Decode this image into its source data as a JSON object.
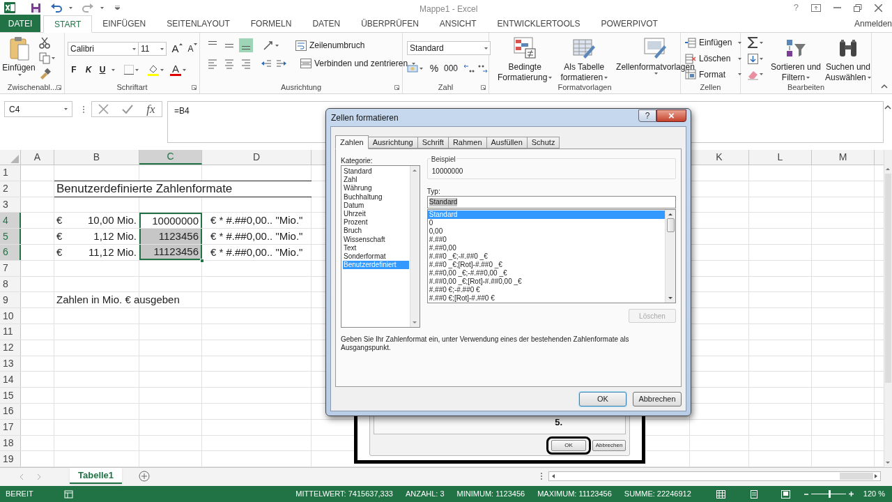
{
  "title_bar": {
    "title": "Mappe1 - Excel",
    "help": "?"
  },
  "ribbon_tabs": [
    {
      "label": "DATEI",
      "kind": "file",
      "selected": false
    },
    {
      "label": "START",
      "kind": "tab",
      "selected": true
    },
    {
      "label": "EINFÜGEN",
      "kind": "tab",
      "selected": false
    },
    {
      "label": "SEITENLAYOUT",
      "kind": "tab",
      "selected": false
    },
    {
      "label": "FORMELN",
      "kind": "tab",
      "selected": false
    },
    {
      "label": "DATEN",
      "kind": "tab",
      "selected": false
    },
    {
      "label": "ÜBERPRÜFEN",
      "kind": "tab",
      "selected": false
    },
    {
      "label": "ANSICHT",
      "kind": "tab",
      "selected": false
    },
    {
      "label": "ENTWICKLERTOOLS",
      "kind": "tab",
      "selected": false
    },
    {
      "label": "POWERPIVOT",
      "kind": "tab",
      "selected": false
    }
  ],
  "account": "Anmelden",
  "ribbon_groups": [
    {
      "kind": "clipboard",
      "label": "Zwischenabl...",
      "paste": "Einfügen"
    },
    {
      "kind": "font",
      "label": "Schriftart",
      "font_name": "Calibri",
      "font_size": "11",
      "grow": "A",
      "shrink": "A",
      "bold": "F",
      "italic": "K",
      "underline": "U",
      "font_color": "A"
    },
    {
      "kind": "alignment",
      "label": "Ausrichtung",
      "vertical_align": [
        {
          "selected": false
        },
        {
          "selected": false
        },
        {
          "selected": true
        }
      ],
      "wrap": "Zeilenumbruch",
      "merge": "Verbinden und zentrieren"
    },
    {
      "kind": "number",
      "label": "Zahl",
      "format": "Standard",
      "percent": "%",
      "thousands": "000"
    },
    {
      "kind": "styles",
      "label": "Formatvorlagen",
      "buttons": [
        [
          "Bedingte",
          "Formatierung"
        ],
        [
          "Als Tabelle",
          "formatieren"
        ],
        [
          "Zellenformatvorlagen"
        ]
      ]
    },
    {
      "kind": "cells",
      "label": "Zellen",
      "buttons": [
        "Einfügen",
        "Löschen",
        "Format"
      ]
    },
    {
      "kind": "editing",
      "label": "Bearbeiten",
      "buttons": [
        [
          "Sortieren und",
          "Filtern"
        ],
        [
          "Suchen und",
          "Auswählen"
        ]
      ]
    }
  ],
  "formula_bar": {
    "name_box": "C4",
    "function": "fx",
    "formula": "=B4"
  },
  "columns": [
    {
      "label": "A",
      "selected": false
    },
    {
      "label": "B",
      "selected": false
    },
    {
      "label": "C",
      "selected": true
    },
    {
      "label": "D",
      "selected": false
    },
    {
      "label": "K",
      "selected": false
    },
    {
      "label": "L",
      "selected": false
    },
    {
      "label": "M",
      "selected": false
    }
  ],
  "rows": [
    {
      "label": "1",
      "selected": false
    },
    {
      "label": "2",
      "selected": false,
      "B": {
        "text": "Benutzerdefinierte Zahlenformate",
        "kind": "title"
      }
    },
    {
      "label": "3",
      "selected": false
    },
    {
      "label": "4",
      "selected": true,
      "B": {
        "currency": "€",
        "text": "10,00 Mio."
      },
      "C": {
        "text": "10000000",
        "selected": true,
        "active": true
      },
      "D": {
        "text": "€ * #.##0,00.. \"Mio.\""
      }
    },
    {
      "label": "5",
      "selected": true,
      "B": {
        "currency": "€",
        "text": "1,12 Mio."
      },
      "C": {
        "text": "1123456",
        "selected": true,
        "active": false
      },
      "D": {
        "text": "€ * #.##0,00.. \"Mio.\""
      }
    },
    {
      "label": "6",
      "selected": true,
      "B": {
        "currency": "€",
        "text": "11,12 Mio."
      },
      "C": {
        "text": "11123456",
        "selected": true,
        "active": false
      },
      "D": {
        "text": "€ * #.##0,00.. \"Mio.\""
      }
    },
    {
      "label": "7",
      "selected": false
    },
    {
      "label": "8",
      "selected": false
    },
    {
      "label": "9",
      "selected": false,
      "B": {
        "text": "Zahlen in Mio. € ausgeben",
        "kind": "note"
      }
    },
    {
      "label": "10",
      "selected": false
    },
    {
      "label": "11",
      "selected": false
    },
    {
      "label": "12",
      "selected": false
    },
    {
      "label": "13",
      "selected": false
    },
    {
      "label": "14",
      "selected": false
    },
    {
      "label": "15",
      "selected": false
    },
    {
      "label": "16",
      "selected": false
    },
    {
      "label": "17",
      "selected": false
    },
    {
      "label": "18",
      "selected": false
    },
    {
      "label": "19",
      "selected": false
    }
  ],
  "dialog": {
    "title": "Zellen formatieren",
    "help": "?",
    "close": "×",
    "tabs": [
      {
        "label": "Zahlen",
        "selected": true
      },
      {
        "label": "Ausrichtung",
        "selected": false
      },
      {
        "label": "Schrift",
        "selected": false
      },
      {
        "label": "Rahmen",
        "selected": false
      },
      {
        "label": "Ausfüllen",
        "selected": false
      },
      {
        "label": "Schutz",
        "selected": false
      }
    ],
    "category_label": "Kategorie:",
    "categories": [
      {
        "label": "Standard",
        "selected": false
      },
      {
        "label": "Zahl",
        "selected": false
      },
      {
        "label": "Währung",
        "selected": false
      },
      {
        "label": "Buchhaltung",
        "selected": false
      },
      {
        "label": "Datum",
        "selected": false
      },
      {
        "label": "Uhrzeit",
        "selected": false
      },
      {
        "label": "Prozent",
        "selected": false
      },
      {
        "label": "Bruch",
        "selected": false
      },
      {
        "label": "Wissenschaft",
        "selected": false
      },
      {
        "label": "Text",
        "selected": false
      },
      {
        "label": "Sonderformat",
        "selected": false
      },
      {
        "label": "Benutzerdefiniert",
        "selected": true
      }
    ],
    "sample_label": "Beispiel",
    "sample": "10000000",
    "type_label": "Typ:",
    "type_field": {
      "value": "Standard",
      "selected": true
    },
    "formats": [
      {
        "label": "Standard",
        "selected": true
      },
      {
        "label": "0",
        "selected": false
      },
      {
        "label": "0,00",
        "selected": false
      },
      {
        "label": "#.##0",
        "selected": false
      },
      {
        "label": "#.##0,00",
        "selected": false
      },
      {
        "label": "#.##0 _€;-#.##0 _€",
        "selected": false
      },
      {
        "label": "#.##0 _€;[Rot]-#.##0 _€",
        "selected": false
      },
      {
        "label": "#.##0,00 _€;-#.##0,00 _€",
        "selected": false
      },
      {
        "label": "#.##0,00 _€;[Rot]-#.##0,00 _€",
        "selected": false
      },
      {
        "label": "#.##0 €;-#.##0 €",
        "selected": false
      },
      {
        "label": "#.##0 €;[Rot]-#.##0 €",
        "selected": false
      }
    ],
    "delete_button": {
      "label": "Löschen",
      "disabled": true
    },
    "hint": "Geben Sie Ihr Zahlenformat ein, unter Verwendung eines der bestehenden Zahlenformate als Ausgangspunkt.",
    "buttons": [
      {
        "label": "OK",
        "focused": true
      },
      {
        "label": "Abbrechen",
        "focused": false
      }
    ]
  },
  "tutorial_callout": {
    "step": "5.",
    "buttons": [
      {
        "label": "OK",
        "circled": true
      },
      {
        "label": "Abbrechen",
        "circled": false
      }
    ]
  },
  "sheets": [
    {
      "label": "Tabelle1",
      "selected": true
    }
  ],
  "status_bar": {
    "mode": "BEREIT",
    "stats": [
      "MITTELWERT: 7415637,333",
      "ANZAHL: 3",
      "MINIMUM: 1123456",
      "MAXIMUM: 11123456",
      "SUMME: 22246912"
    ],
    "zoom_slider": {
      "level": 0.52
    },
    "zoom": "120 %"
  }
}
